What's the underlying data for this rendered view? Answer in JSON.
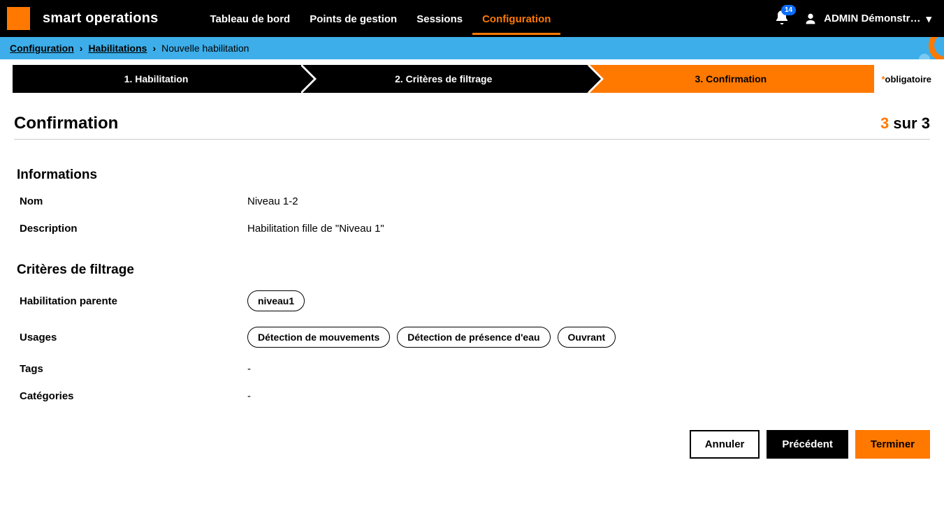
{
  "header": {
    "app_title": "smart operations",
    "nav": [
      {
        "label": "Tableau de bord",
        "active": false
      },
      {
        "label": "Points de gestion",
        "active": false
      },
      {
        "label": "Sessions",
        "active": false
      },
      {
        "label": "Configuration",
        "active": true
      }
    ],
    "notif_count": "14",
    "user_label": "ADMIN Démonstr…"
  },
  "breadcrumb": {
    "items": [
      {
        "label": "Configuration",
        "link": true
      },
      {
        "label": "Habilitations",
        "link": true
      },
      {
        "label": "Nouvelle habilitation",
        "link": false
      }
    ]
  },
  "stepper": {
    "steps": [
      {
        "label": "1. Habilitation"
      },
      {
        "label": "2. Critères de filtrage"
      },
      {
        "label": "3. Confirmation"
      }
    ],
    "mandatory_label": "obligatoire"
  },
  "page": {
    "title": "Confirmation",
    "step_current": "3",
    "step_sep": "sur",
    "step_total": "3"
  },
  "info_section": {
    "heading": "Informations",
    "rows": {
      "nom_label": "Nom",
      "nom_value": "Niveau 1-2",
      "desc_label": "Description",
      "desc_value": "Habilitation fille de \"Niveau 1\""
    }
  },
  "criteria_section": {
    "heading": "Critères de filtrage",
    "parent_label": "Habilitation parente",
    "parent_chip": "niveau1",
    "usages_label": "Usages",
    "usages": [
      "Détection de mouvements",
      "Détection de présence d'eau",
      "Ouvrant"
    ],
    "tags_label": "Tags",
    "tags_value": "-",
    "cat_label": "Catégories",
    "cat_value": "-"
  },
  "footer": {
    "cancel": "Annuler",
    "prev": "Précédent",
    "finish": "Terminer"
  }
}
